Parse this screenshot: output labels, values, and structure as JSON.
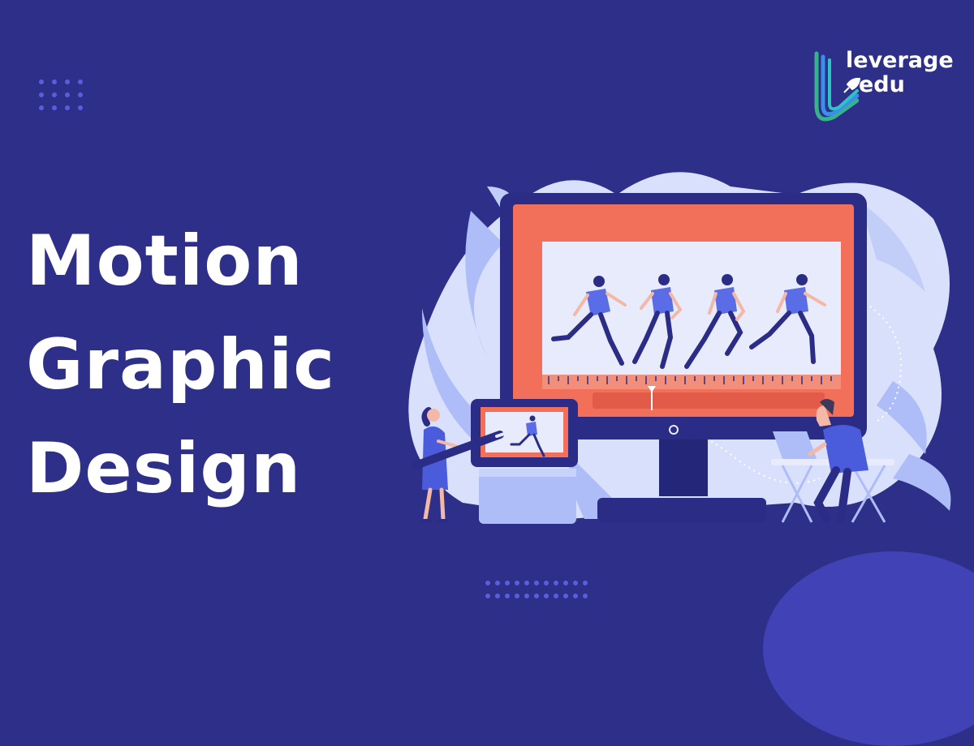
{
  "headline": {
    "line1": "Motion",
    "line2": "Graphic",
    "line3": "Design"
  },
  "logo": {
    "line1": "leverage",
    "line2": "edu"
  },
  "colors": {
    "background": "#2d2f88",
    "accent_blue": "#5a5de0",
    "monitor_screen": "#f2705a",
    "logo_green": "#37b38a",
    "logo_blue": "#3c8fe8"
  },
  "icons": [
    "dot-grid-decoration",
    "leverage-edu-logo-mark",
    "rocket-icon",
    "monitor-illustration",
    "tablet-illustration"
  ]
}
